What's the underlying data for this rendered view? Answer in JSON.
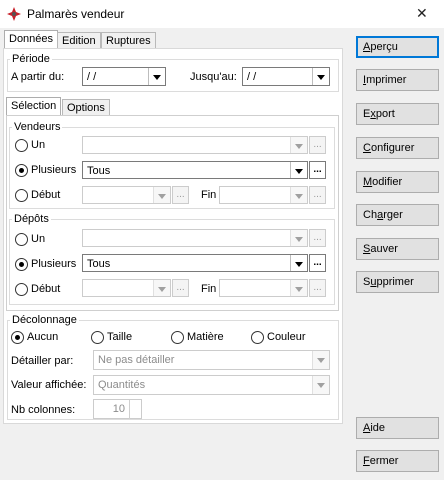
{
  "window": {
    "title": "Palmarès vendeur",
    "close_glyph": "✕"
  },
  "tabs": [
    "Données",
    "Edition",
    "Ruptures"
  ],
  "periode": {
    "label": "Période",
    "from_label": "A partir du:",
    "from_value": " / /",
    "to_label": "Jusqu'au:",
    "to_value": " / /"
  },
  "subtabs": [
    "Sélection",
    "Options"
  ],
  "vendeurs": {
    "label": "Vendeurs",
    "opt_un": "Un",
    "opt_plusieurs": "Plusieurs",
    "plusieurs_value": "Tous",
    "opt_debut": "Début",
    "fin_label": "Fin"
  },
  "depots": {
    "label": "Dépôts",
    "opt_un": "Un",
    "opt_plusieurs": "Plusieurs",
    "plusieurs_value": "Tous",
    "opt_debut": "Début",
    "fin_label": "Fin"
  },
  "ellipsis": "...",
  "decolonnage": {
    "label": "Décolonnage",
    "options": [
      "Aucun",
      "Taille",
      "Matière",
      "Couleur"
    ],
    "selected": "Aucun",
    "detailler_label": "Détailler par:",
    "detailler_value": "Ne pas détailler",
    "valeur_label": "Valeur affichée:",
    "valeur_value": "Quantités",
    "nbcol_label": "Nb colonnes:",
    "nbcol_value": "10"
  },
  "buttons": {
    "apercu": [
      "A",
      "perçu"
    ],
    "imprimer": [
      "I",
      "mprimer"
    ],
    "exporter": [
      "E",
      "x",
      "port"
    ],
    "configurer": [
      "C",
      "onfigurer"
    ],
    "modifier": [
      "M",
      "odifier"
    ],
    "charger": [
      "Ch",
      "a",
      "rger"
    ],
    "sauver": [
      "S",
      "auver"
    ],
    "supprimer": [
      "S",
      "u",
      "pprimer"
    ],
    "aide": [
      "A",
      "ide"
    ],
    "fermer": [
      "F",
      "ermer"
    ]
  },
  "colors": {
    "accent": "#0078d7",
    "icon_red": "#c8202a"
  }
}
